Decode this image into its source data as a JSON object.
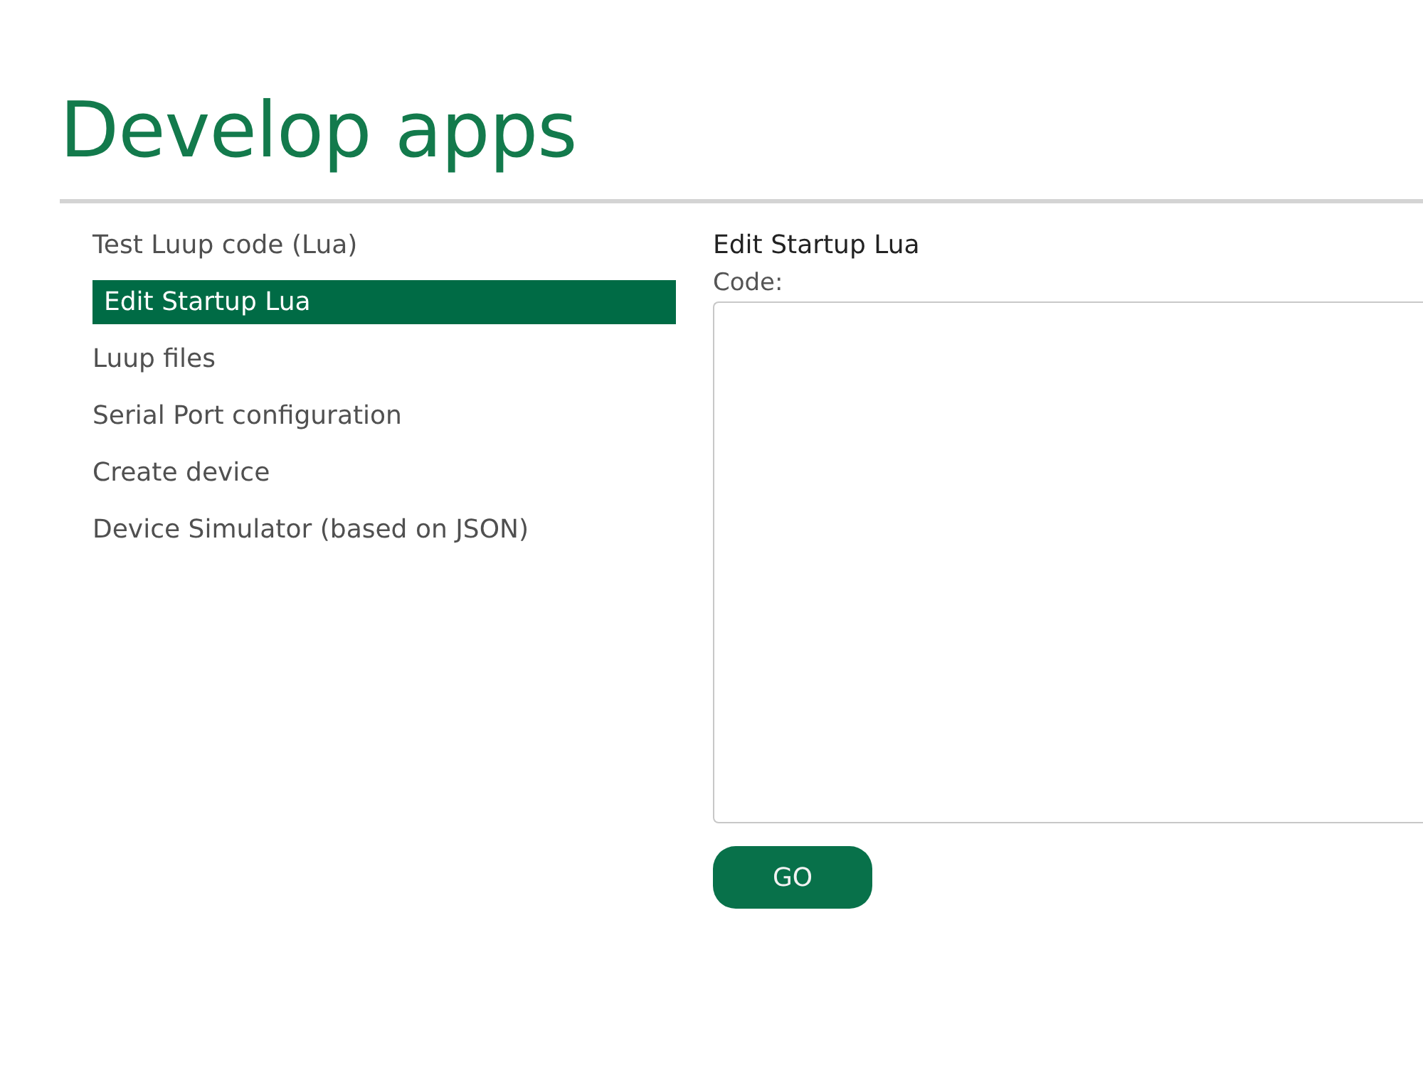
{
  "page": {
    "title": "Develop apps"
  },
  "sidebar": {
    "items": [
      {
        "label": "Test Luup code (Lua)",
        "selected": false
      },
      {
        "label": "Edit Startup Lua",
        "selected": true
      },
      {
        "label": "Luup files",
        "selected": false
      },
      {
        "label": "Serial Port configuration",
        "selected": false
      },
      {
        "label": "Create device",
        "selected": false
      },
      {
        "label": "Device Simulator (based on JSON)",
        "selected": false
      }
    ]
  },
  "panel": {
    "title": "Edit Startup Lua",
    "code_label": "Code:",
    "button": "GO"
  }
}
